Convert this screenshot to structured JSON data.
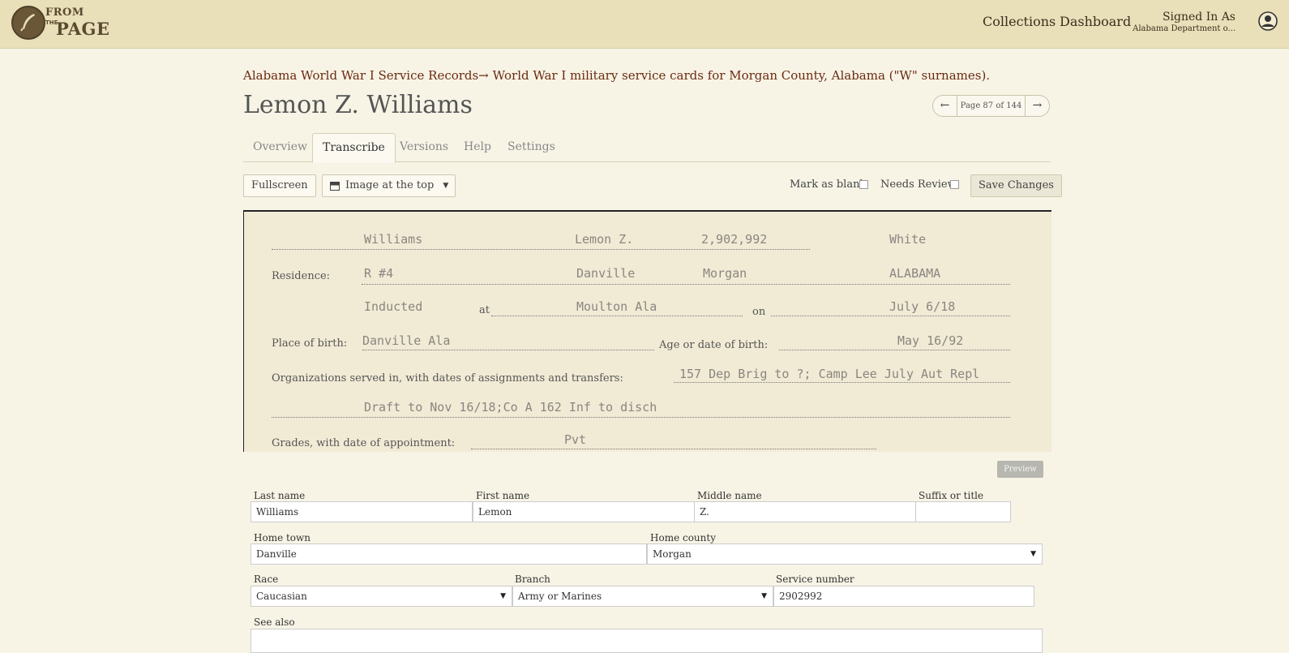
{
  "header": {
    "logo": {
      "from": "FROM",
      "the": "THE",
      "page": "PAGE"
    },
    "nav": {
      "collections": "Collections",
      "dashboard": "Dashboard"
    },
    "signed_in": {
      "title": "Signed In As",
      "user": "Alabama Department o..."
    }
  },
  "breadcrumb": {
    "collection": "Alabama World War I Service Records",
    "arrow": "→",
    "work": "World War I military service cards for Morgan County, Alabama (\"W\" surnames)."
  },
  "page": {
    "title": "Lemon Z. Williams",
    "pager_label": "Page 87 of 144"
  },
  "tabs": [
    {
      "label": "Overview"
    },
    {
      "label": "Transcribe"
    },
    {
      "label": "Versions"
    },
    {
      "label": "Help"
    },
    {
      "label": "Settings"
    }
  ],
  "toolbar": {
    "fullscreen": "Fullscreen",
    "layout_select": "Image at the top",
    "mark_blank": "Mark as blank",
    "needs_review": "Needs Review",
    "save": "Save Changes"
  },
  "document_card": {
    "surname": "Williams",
    "given": "Lemon Z.",
    "serial": "2,902,992",
    "race": "White",
    "residence_label": "Residence:",
    "residence_addr": "R #4",
    "residence_town": "Danville",
    "residence_county": "Morgan",
    "residence_state": "ALABAMA",
    "inducted": "Inducted",
    "at_label": "at",
    "inducted_place": "Moulton Ala",
    "on_label": "on",
    "inducted_date": "July 6/18",
    "birth_place_label": "Place of birth:",
    "birth_place": "Danville Ala",
    "age_label": "Age or date of birth:",
    "birth_date": "May 16/92",
    "org_label": "Organizations served in, with dates of assignments and transfers:",
    "org_line1": "157 Dep Brig to ?; Camp Lee July Aut Repl",
    "org_line2": "Draft to Nov 16/18;Co A 162 Inf to disch",
    "grades_label": "Grades, with date of appointment:",
    "grade": "Pvt"
  },
  "form": {
    "preview": "Preview",
    "last_name": {
      "label": "Last name",
      "value": "Williams"
    },
    "first_name": {
      "label": "First name",
      "value": "Lemon"
    },
    "middle_name": {
      "label": "Middle name",
      "value": "Z."
    },
    "suffix": {
      "label": "Suffix or title",
      "value": ""
    },
    "home_town": {
      "label": "Home town",
      "value": "Danville"
    },
    "home_county": {
      "label": "Home county",
      "value": "Morgan"
    },
    "race": {
      "label": "Race",
      "value": "Caucasian"
    },
    "branch": {
      "label": "Branch",
      "value": "Army or Marines"
    },
    "service_number": {
      "label": "Service number",
      "value": "2902992"
    },
    "see_also": {
      "label": "See also",
      "value": ""
    }
  },
  "colors": {
    "header_bg": "#e9dfb9",
    "page_bg": "#f7f4e6",
    "link": "#6b2a10"
  }
}
